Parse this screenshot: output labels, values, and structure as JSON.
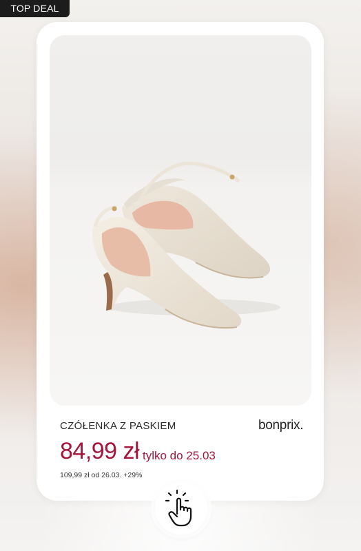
{
  "badge": {
    "label": "TOP DEAL"
  },
  "product": {
    "title": "CZÓŁENKA Z PASKIEM",
    "brand": "bonprix.",
    "price": "84,99 zł",
    "deal_note": "tylko do 25.03",
    "regular_price_note": "109,99 zł od 26.03. +29%",
    "image_icon": "cream-slingback-pumps-image"
  },
  "cta": {
    "icon": "tap-hand-icon"
  },
  "colors": {
    "price": "#a7153a",
    "badge_bg": "#1c1c1c",
    "card_bg": "#ffffff"
  }
}
